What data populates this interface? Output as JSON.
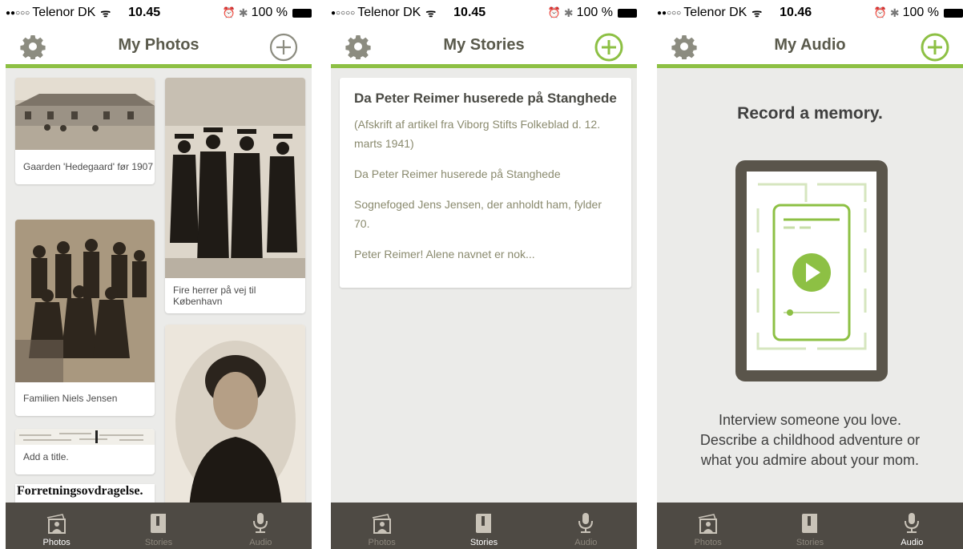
{
  "status": {
    "signal_photos": "●●○○○",
    "signal_stories": "●○○○○",
    "signal_audio": "●●○○○",
    "carrier": "Telenor DK",
    "time_photos": "10.45",
    "time_stories": "10.45",
    "time_audio": "10.46",
    "battery": "100 %"
  },
  "photos_screen": {
    "title": "My Photos",
    "photos": [
      {
        "caption": "Gaarden 'Hedegaard' før 1907"
      },
      {
        "caption": "Familien Niels Jensen"
      },
      {
        "caption": "Add a title."
      },
      {
        "caption": "Forretningsovdragelse."
      },
      {
        "caption": "Fire herrer på vej til København"
      },
      {
        "caption": ""
      }
    ]
  },
  "stories_screen": {
    "title": "My Stories",
    "story": {
      "title": "Da Peter Reimer huserede på Stanghede",
      "paragraphs": [
        "(Afskrift af artikel fra Viborg Stifts Folkeblad d. 12. marts 1941)",
        "Da Peter Reimer huserede på Stanghede",
        "Sognefoged Jens Jensen, der anholdt ham, fylder 70.",
        "Peter Reimer! Alene navnet er nok..."
      ]
    }
  },
  "audio_screen": {
    "title": "My Audio",
    "heading": "Record a memory.",
    "lines": [
      "Interview someone you love.",
      "Describe a childhood adventure or",
      "what you admire about your mom."
    ]
  },
  "tabs": {
    "photos": "Photos",
    "stories": "Stories",
    "audio": "Audio"
  },
  "colors": {
    "accent_green": "#8dc044",
    "tab_bar": "#4e4a44",
    "nav_icon_gray": "#8c8c80"
  },
  "icons": [
    "gear-icon",
    "add-circle-icon",
    "photos-tab-icon",
    "stories-tab-icon",
    "microphone-icon",
    "play-icon"
  ]
}
